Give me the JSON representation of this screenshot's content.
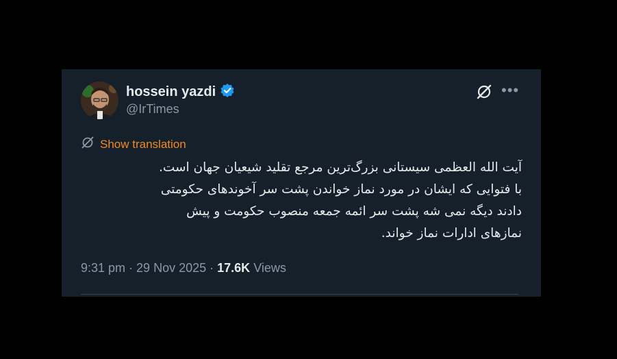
{
  "author": {
    "name": "hossein yazdi",
    "handle": "@IrTimes",
    "verified": true
  },
  "translate": {
    "label": "Show translation"
  },
  "tweet": {
    "lines": [
      "آیت الله العظمی سیستانی بزرگ‌ترین مرجع تقلید شیعیان جهان است.",
      "با فتوایی که ایشان در مورد نماز خواندن پشت سر آخوندهای حکومتی",
      "دادند دیگه نمی شه پشت سر ائمه جمعه منصوب حکومت و پیش",
      "نمازهای ادارات نماز خواند."
    ]
  },
  "meta": {
    "time": "9:31 pm",
    "separator": " · ",
    "date": "29 Nov 2025",
    "views_count": "17.6K",
    "views_label": "Views"
  },
  "colors": {
    "background": "#15202b",
    "verified_badge": "#1d9bf0",
    "translate_accent": "#f08a24"
  },
  "icons": {
    "verified": "verified-badge-icon",
    "grok": "grok-icon",
    "more": "more-icon",
    "translate": "translate-icon"
  }
}
